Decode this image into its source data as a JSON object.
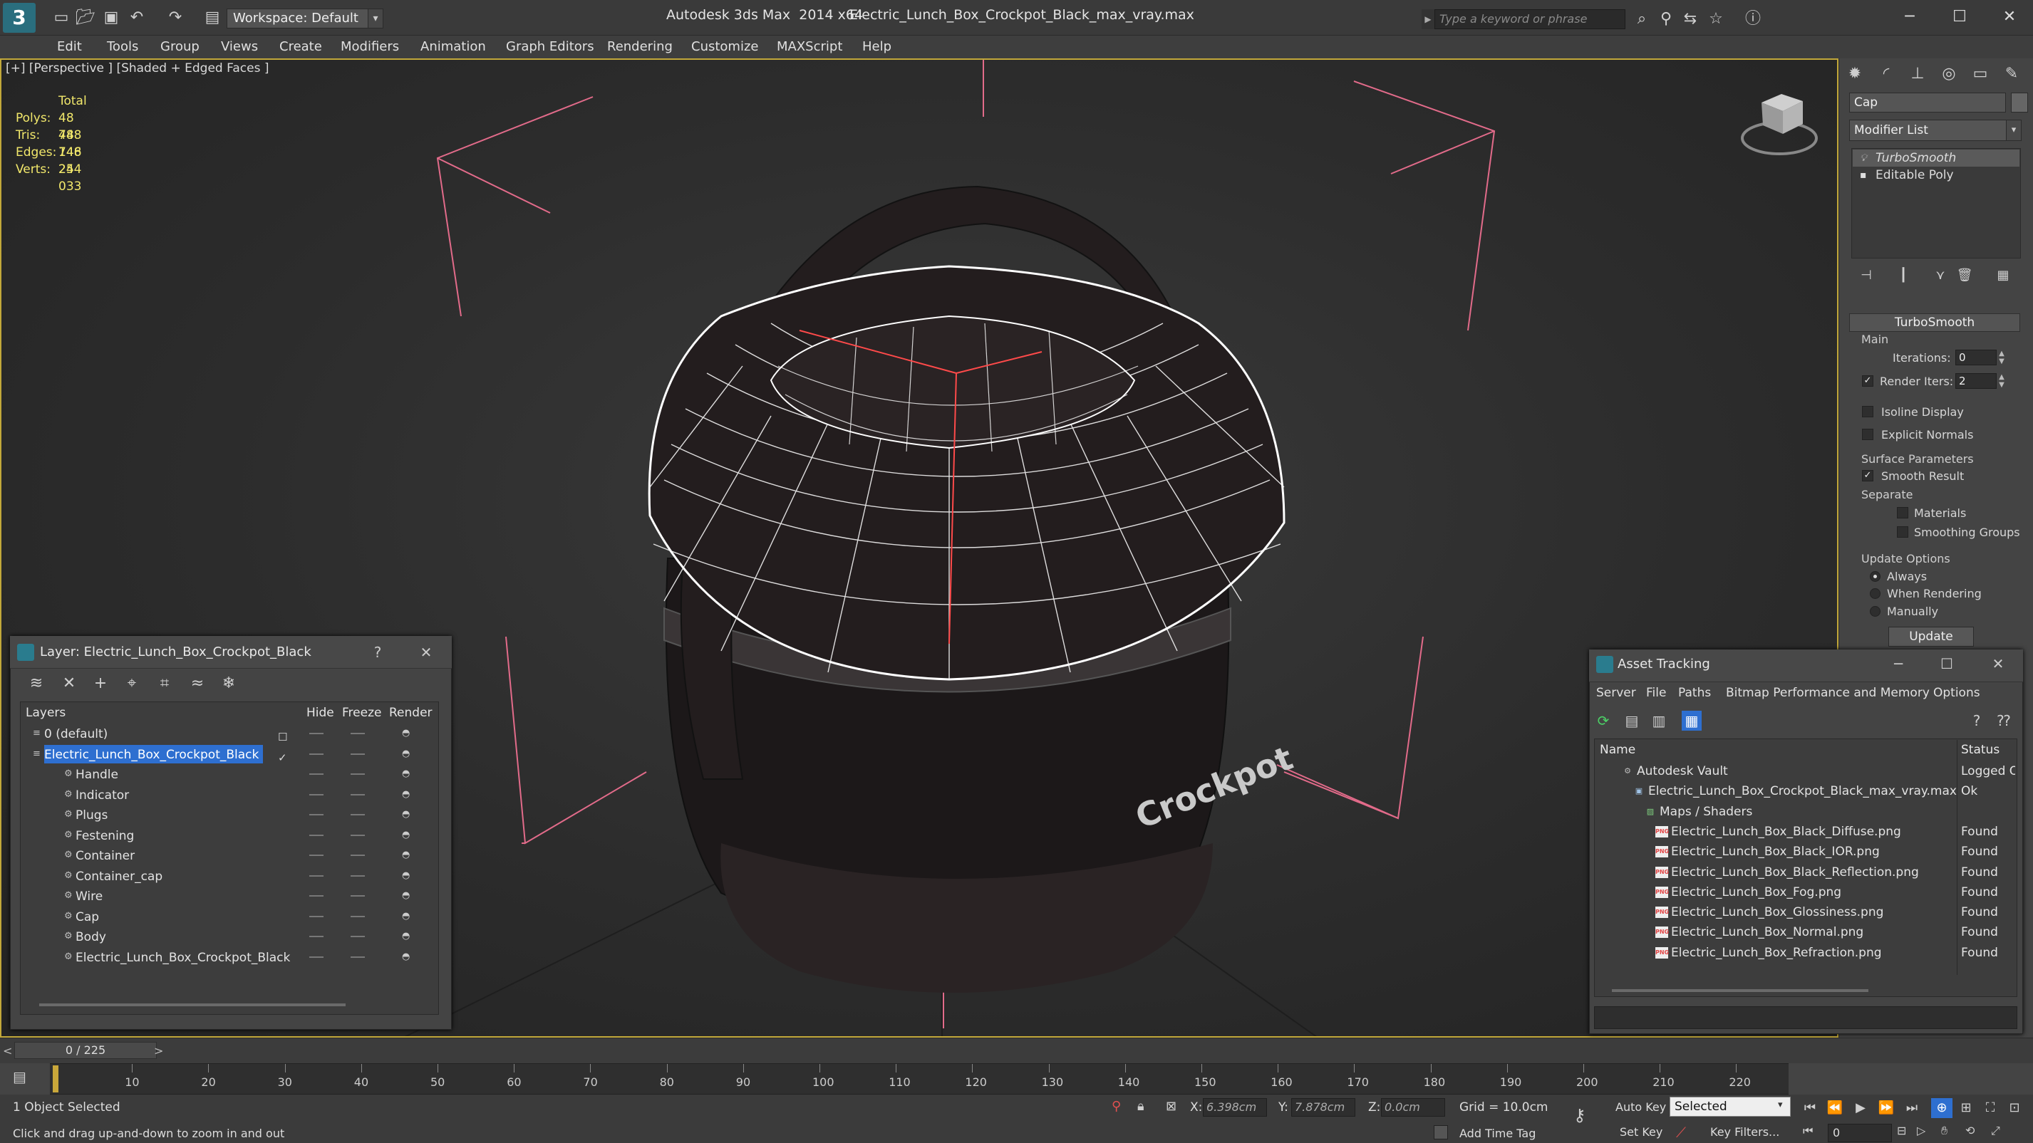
{
  "titlebar": {
    "workspace": "Workspace: Default",
    "app_title": "Autodesk 3ds Max  2014 x64",
    "doc_title": "Electric_Lunch_Box_Crockpot_Black_max_vray.max",
    "search_placeholder": "Type a keyword or phrase"
  },
  "menu": [
    "Edit",
    "Tools",
    "Group",
    "Views",
    "Create",
    "Modifiers",
    "Animation",
    "Graph Editors",
    "Rendering",
    "Customize",
    "MAXScript",
    "Help"
  ],
  "viewport": {
    "label": "[+] [Perspective ] [Shaded + Edged Faces ]",
    "stats": {
      "header": "Total",
      "rows": [
        {
          "k": "Polys:",
          "v": "48 748"
        },
        {
          "k": "Tris:",
          "v": "48 748"
        },
        {
          "k": "Edges:",
          "v": "146 244"
        },
        {
          "k": "Verts:",
          "v": "25 033"
        }
      ]
    },
    "model_label": "Crockpot",
    "wire_color": "#ffffff",
    "body_color": "#1c1819",
    "bracket_color": "#e26b8a"
  },
  "command_panel": {
    "object_name": "Cap",
    "modifier_list": "Modifier List",
    "stack": [
      "TurboSmooth",
      "Editable Poly"
    ],
    "rollout": "TurboSmooth",
    "main": "Main",
    "iterations_label": "Iterations:",
    "iterations": "0",
    "render_iters_label": "Render Iters:",
    "render_iters": "2",
    "isoline": "Isoline Display",
    "explicit_normals": "Explicit Normals",
    "surface_params": "Surface Parameters",
    "smooth_result": "Smooth Result",
    "separate": "Separate",
    "materials": "Materials",
    "smoothing_groups": "Smoothing Groups",
    "update_options": "Update Options",
    "always": "Always",
    "when_rendering": "When Rendering",
    "manually": "Manually",
    "update": "Update"
  },
  "layer_dialog": {
    "title": "Layer: Electric_Lunch_Box_Crockpot_Black",
    "help": "?",
    "close": "✕",
    "columns": [
      "Layers",
      "Hide",
      "Freeze",
      "Render"
    ],
    "rows": [
      {
        "name": "0 (default)",
        "level": 0,
        "type": "layer"
      },
      {
        "name": "Electric_Lunch_Box_Crockpot_Black",
        "level": 0,
        "type": "layer",
        "selected": true
      },
      {
        "name": "Handle",
        "level": 1,
        "type": "obj"
      },
      {
        "name": "Indicator",
        "level": 1,
        "type": "obj"
      },
      {
        "name": "Plugs",
        "level": 1,
        "type": "obj"
      },
      {
        "name": "Festening",
        "level": 1,
        "type": "obj"
      },
      {
        "name": "Container",
        "level": 1,
        "type": "obj"
      },
      {
        "name": "Container_cap",
        "level": 1,
        "type": "obj"
      },
      {
        "name": "Wire",
        "level": 1,
        "type": "obj"
      },
      {
        "name": "Cap",
        "level": 1,
        "type": "obj"
      },
      {
        "name": "Body",
        "level": 1,
        "type": "obj"
      },
      {
        "name": "Electric_Lunch_Box_Crockpot_Black",
        "level": 1,
        "type": "obj"
      }
    ]
  },
  "asset_dialog": {
    "title": "Asset Tracking",
    "menu": [
      "Server",
      "File",
      "Paths",
      "Bitmap Performance and Memory",
      "Options"
    ],
    "columns": [
      "Name",
      "Status"
    ],
    "rows": [
      {
        "name": "Autodesk Vault",
        "status": "Logged O",
        "level": 1,
        "icon": "vault"
      },
      {
        "name": "Electric_Lunch_Box_Crockpot_Black_max_vray.max",
        "status": "Ok",
        "level": 2,
        "icon": "max"
      },
      {
        "name": "Maps / Shaders",
        "status": "",
        "level": 3,
        "icon": "maps"
      },
      {
        "name": "Electric_Lunch_Box_Black_Diffuse.png",
        "status": "Found",
        "level": 4,
        "icon": "png"
      },
      {
        "name": "Electric_Lunch_Box_Black_IOR.png",
        "status": "Found",
        "level": 4,
        "icon": "png"
      },
      {
        "name": "Electric_Lunch_Box_Black_Reflection.png",
        "status": "Found",
        "level": 4,
        "icon": "png"
      },
      {
        "name": "Electric_Lunch_Box_Fog.png",
        "status": "Found",
        "level": 4,
        "icon": "png"
      },
      {
        "name": "Electric_Lunch_Box_Glossiness.png",
        "status": "Found",
        "level": 4,
        "icon": "png"
      },
      {
        "name": "Electric_Lunch_Box_Normal.png",
        "status": "Found",
        "level": 4,
        "icon": "png"
      },
      {
        "name": "Electric_Lunch_Box_Refraction.png",
        "status": "Found",
        "level": 4,
        "icon": "png"
      }
    ]
  },
  "timeline": {
    "slider": "0 / 225",
    "ticks": [
      "10",
      "20",
      "30",
      "40",
      "50",
      "60",
      "70",
      "80",
      "90",
      "100",
      "110",
      "120",
      "130",
      "140",
      "150",
      "160",
      "170",
      "180",
      "190",
      "200",
      "210",
      "220"
    ]
  },
  "status": {
    "selected": "1 Object Selected",
    "hint": "Click and drag up-and-down to zoom in and out",
    "x_label": "X:",
    "x": "6.398cm",
    "y_label": "Y:",
    "y": "7.878cm",
    "z_label": "Z:",
    "z": "0.0cm",
    "grid": "Grid = 10.0cm",
    "add_time_tag": "Add Time Tag",
    "auto_key": "Auto Key",
    "set_key": "Set Key",
    "key_mode": "Selected",
    "key_filters": "Key Filters...",
    "frame": "0"
  }
}
